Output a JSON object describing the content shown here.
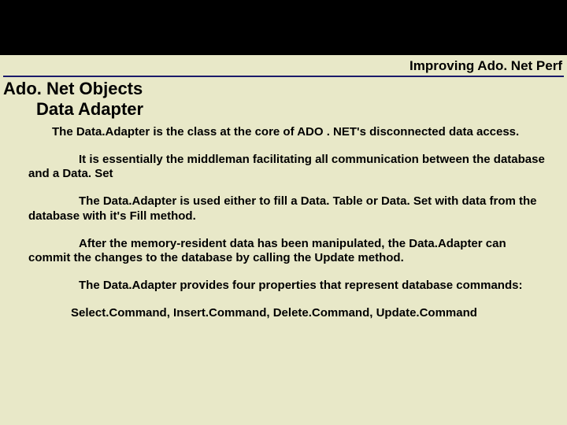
{
  "header": {
    "right_title": "Improving Ado. Net Perf"
  },
  "section": {
    "line1": "Ado. Net Objects",
    "line2": "Data Adapter"
  },
  "body": {
    "p1": "The Data.Adapter is the class at the core of ADO . NET's disconnected data access.",
    "p2": "It is essentially the middleman facilitating all communication between the database and a Data. Set",
    "p3": "The Data.Adapter is used either to fill a Data. Table or Data. Set with data from the database with it's Fill method.",
    "p4": "After the memory-resident data has been manipulated, the Data.Adapter can commit the changes to the database by calling the Update method.",
    "p5": "The Data.Adapter provides four properties that represent database commands:",
    "commands": "Select.Command, Insert.Command, Delete.Command, Update.Command"
  }
}
